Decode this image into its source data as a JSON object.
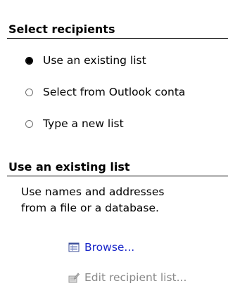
{
  "select_recipients": {
    "header": "Select recipients",
    "options": [
      {
        "label": "Use an existing list",
        "checked": true
      },
      {
        "label": "Select from Outlook conta",
        "checked": false
      },
      {
        "label": "Type a new list",
        "checked": false
      }
    ]
  },
  "use_existing_list": {
    "header": "Use an existing list",
    "description_line1": "Use names and addresses",
    "description_line2": "from a file or a database.",
    "browse_label": "Browse...",
    "browse_icon": "address-book-icon",
    "edit_label": "Edit recipient list...",
    "edit_icon": "edit-list-icon"
  },
  "colors": {
    "link": "#1a27c9",
    "disabled": "#8a8a8a"
  }
}
